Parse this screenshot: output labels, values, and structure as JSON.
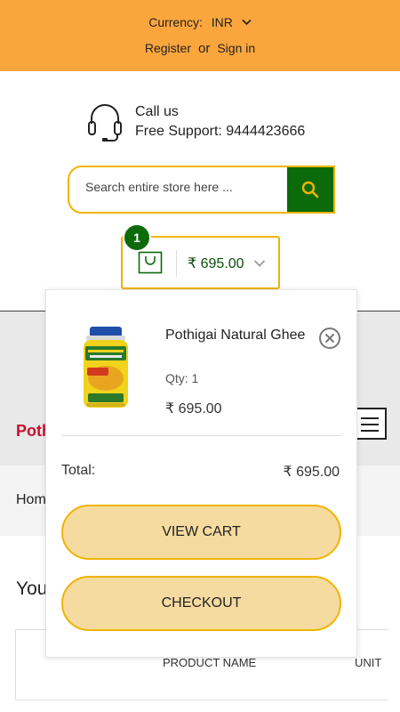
{
  "header": {
    "currency_label": "Currency:",
    "currency_value": "INR",
    "register": "Register",
    "or": "or",
    "sign_in": "Sign in"
  },
  "support": {
    "title": "Call us",
    "line": "Free Support: 9444423666",
    "icon": "headset-icon"
  },
  "search": {
    "placeholder": "Search entire store here ...",
    "icon": "search-icon"
  },
  "mini_cart": {
    "count": "1",
    "amount": "₹ 695.00",
    "icon": "shopping-bag-icon"
  },
  "background": {
    "logo_fragment": "Poth",
    "breadcrumb_fragment": "Hom",
    "heading_fragment": "You",
    "col_product": "PRODUCT NAME",
    "col_unit": "UNIT"
  },
  "dropdown": {
    "product_name": "Pothigai Natural Ghee",
    "qty": "Qty: 1",
    "price": "₹ 695.00",
    "total_label": "Total:",
    "total_value": "₹ 695.00",
    "view_cart": "VIEW CART",
    "checkout": "CHECKOUT"
  },
  "colors": {
    "topbar": "#fba63d",
    "accent_green": "#0b6b0b",
    "border_yellow": "#f0b400",
    "button_fill": "#f5dba0"
  }
}
